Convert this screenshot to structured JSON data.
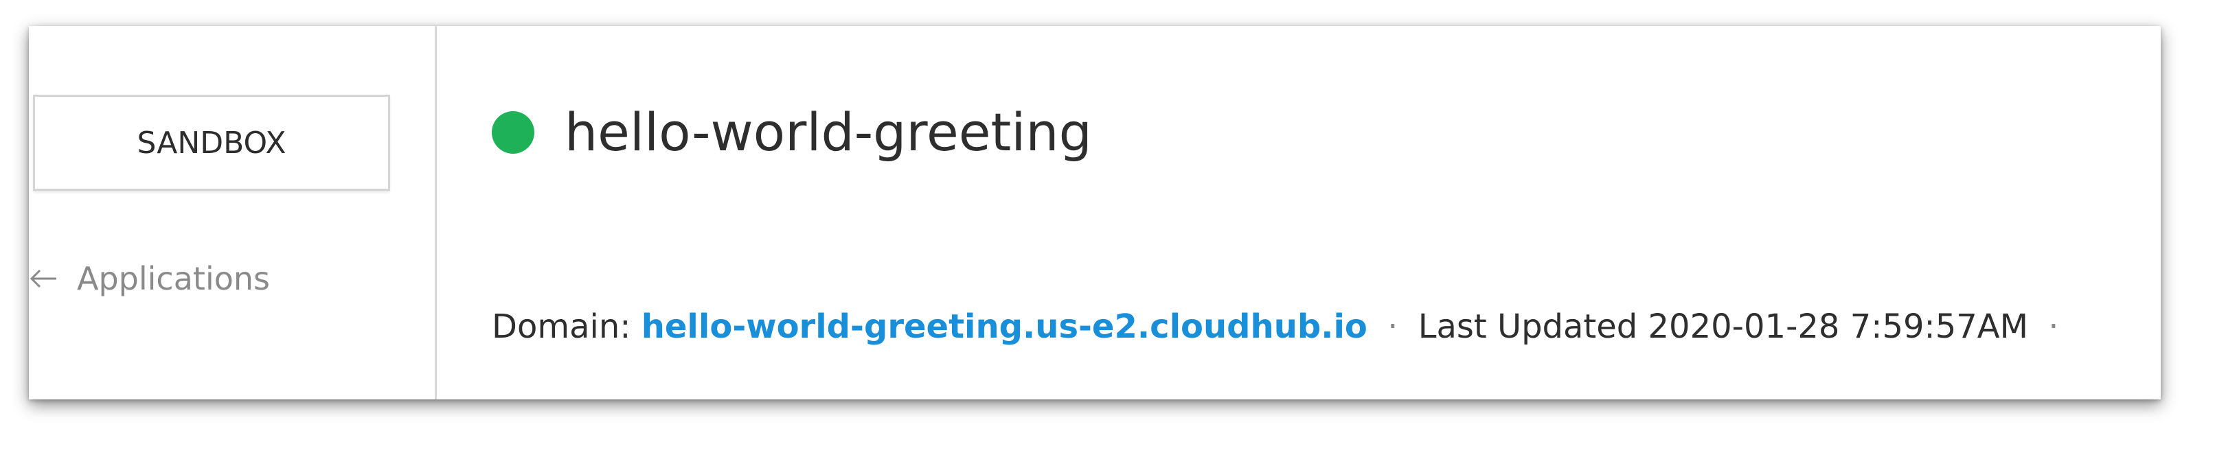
{
  "environment": {
    "label": "SANDBOX"
  },
  "navigation": {
    "back_label": "Applications",
    "back_icon": "arrow-left-icon"
  },
  "application": {
    "name": "hello-world-greeting",
    "status_color": "#1fb158",
    "domain_label": "Domain:",
    "domain_value": "hello-world-greeting.us-e2.cloudhub.io",
    "separator": "·",
    "last_updated_label": "Last Updated",
    "last_updated_value": "2020-01-28 7:59:57AM",
    "trailing_separator": "·"
  },
  "colors": {
    "link": "#1a8fd9",
    "status_running": "#1fb158"
  }
}
